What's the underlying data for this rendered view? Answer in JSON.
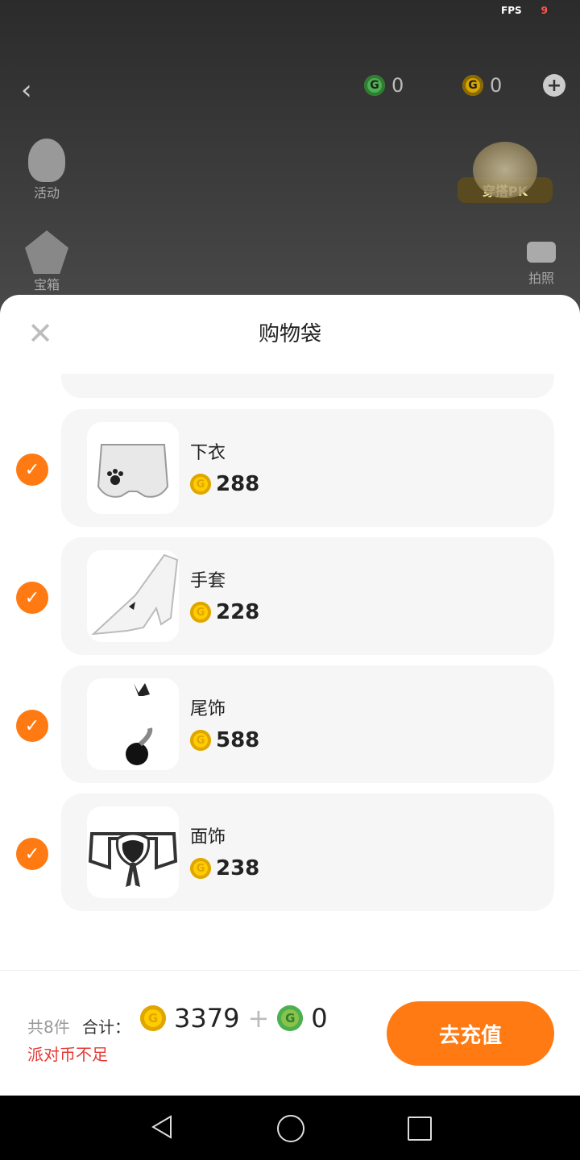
{
  "status": {
    "fps_label": "FPS",
    "fps_value": "9"
  },
  "header": {
    "green_coin_count": "0",
    "gold_coin_count": "0",
    "add_label": "+"
  },
  "side_menu": [
    {
      "label": "活动",
      "icon": "balloon-icon"
    },
    {
      "label": "宝箱",
      "icon": "treasure-icon"
    }
  ],
  "pk_badge": {
    "label": "穿搭PK"
  },
  "camera": {
    "label": "拍照"
  },
  "sheet": {
    "title": "购物袋",
    "close_label": "✕",
    "items": [
      {
        "name": "下衣",
        "price": "288",
        "checked": true,
        "icon": "pants-thumbnail"
      },
      {
        "name": "手套",
        "price": "228",
        "checked": true,
        "icon": "glove-thumbnail"
      },
      {
        "name": "尾饰",
        "price": "588",
        "checked": true,
        "icon": "tail-thumbnail"
      },
      {
        "name": "面饰",
        "price": "238",
        "checked": true,
        "icon": "bow-thumbnail"
      }
    ]
  },
  "footer": {
    "count_label": "共8件",
    "sum_label": "合计：",
    "gold_total": "3379",
    "plus": "+",
    "green_total": "0",
    "warning": "派对币不足",
    "pay_button": "去充值"
  },
  "colors": {
    "accent": "#ff7a12",
    "warning": "#e53935",
    "card_bg": "#f6f6f7"
  }
}
